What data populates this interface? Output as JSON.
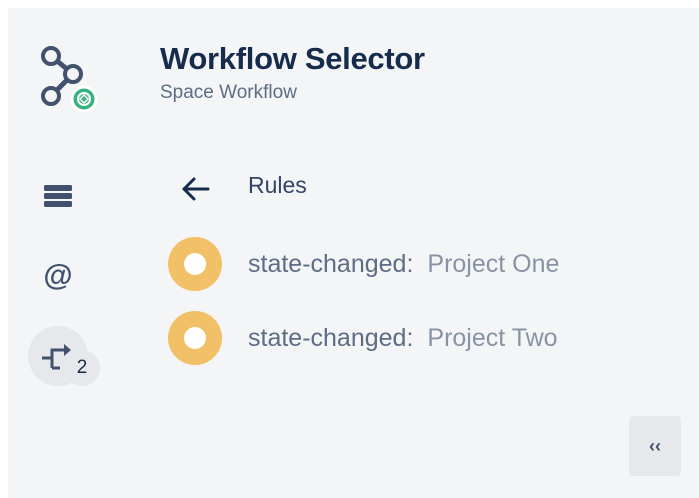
{
  "header": {
    "title": "Workflow Selector",
    "subtitle": "Space Workflow",
    "logo_icon": "workflow-connector-logo"
  },
  "sidebar": {
    "items": [
      {
        "name": "rules-list",
        "icon": "stack-icon",
        "active": false
      },
      {
        "name": "mentions",
        "icon": "at-icon",
        "label": "@",
        "active": false
      },
      {
        "name": "transitions",
        "icon": "transition-arrow-icon",
        "active": true,
        "badge": "2"
      }
    ]
  },
  "section": {
    "back_icon": "arrow-left-icon",
    "title": "Rules"
  },
  "rules": [
    {
      "event": "state-changed:",
      "target": "Project One",
      "status_color": "#f2c066"
    },
    {
      "event": "state-changed:",
      "target": "Project Two",
      "status_color": "#f2c066"
    }
  ],
  "footer": {
    "collapse_label": "‹‹"
  },
  "colors": {
    "panel_bg": "#f4f5f7",
    "title": "#172b4d",
    "muted": "#5e6c84",
    "status": "#f2c066",
    "logo_green": "#36b37e",
    "icon_dark": "#42526e"
  }
}
